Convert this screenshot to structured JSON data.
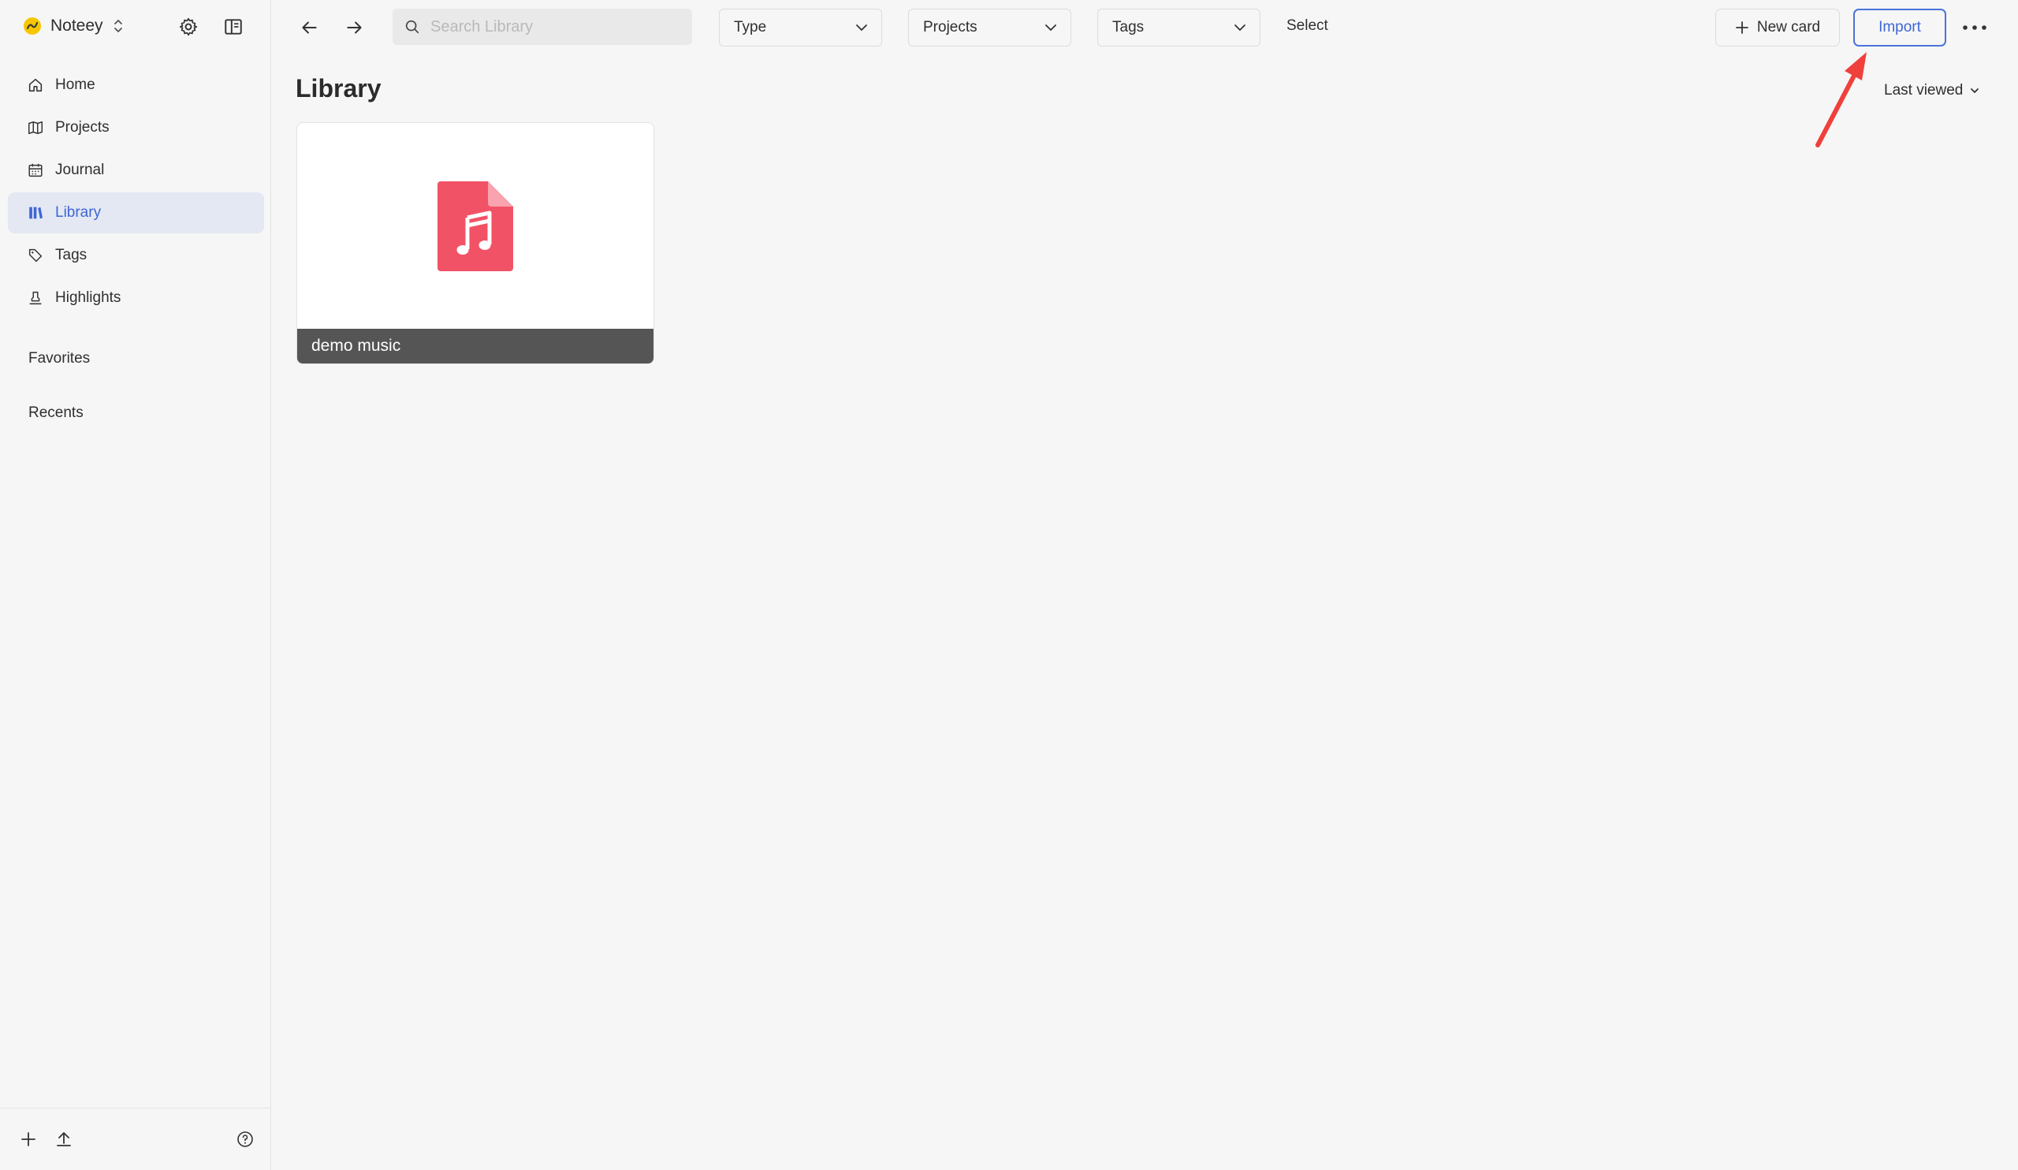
{
  "workspace": {
    "name": "Noteey"
  },
  "sidebar": {
    "items": [
      {
        "label": "Home",
        "icon": "home-icon"
      },
      {
        "label": "Projects",
        "icon": "map-icon"
      },
      {
        "label": "Journal",
        "icon": "calendar-icon"
      },
      {
        "label": "Library",
        "icon": "library-icon",
        "active": true
      },
      {
        "label": "Tags",
        "icon": "tag-icon"
      },
      {
        "label": "Highlights",
        "icon": "highlighter-icon"
      }
    ],
    "sections": {
      "favorites": "Favorites",
      "recents": "Recents"
    }
  },
  "toolbar": {
    "search_placeholder": "Search Library",
    "filters": [
      "Type",
      "Projects",
      "Tags"
    ],
    "select_label": "Select",
    "new_card_label": "New card",
    "import_label": "Import"
  },
  "main": {
    "title": "Library",
    "sort_label": "Last viewed",
    "cards": [
      {
        "title": "demo music",
        "type_icon": "music-file-icon"
      }
    ]
  },
  "colors": {
    "accent": "#3e66d6",
    "active_bg": "#e4e8f3",
    "music_file": "#f25266",
    "annotation_arrow": "#f0403c",
    "logo": "#f6c700"
  }
}
